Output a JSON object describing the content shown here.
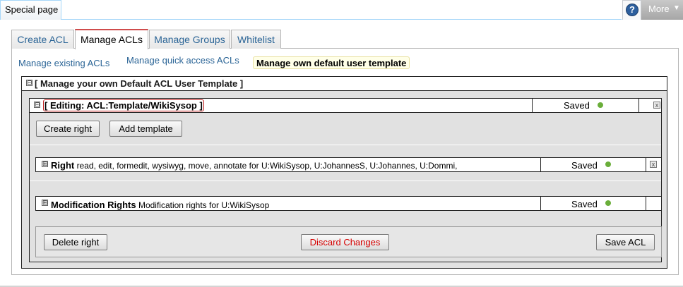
{
  "header": {
    "special_page": "Special page",
    "help_icon_glyph": "?",
    "more_label": "More",
    "more_arrow": "▼"
  },
  "tabs": [
    {
      "label": "Create ACL"
    },
    {
      "label": "Manage ACLs"
    },
    {
      "label": "Manage Groups"
    },
    {
      "label": "Whitelist"
    }
  ],
  "active_tab": "Manage ACLs",
  "subtabs": [
    {
      "label": "Manage existing ACLs"
    },
    {
      "label": "Manage quick access ACLs"
    },
    {
      "label": "Manage own default user template"
    }
  ],
  "active_subtab": "Manage own default user template",
  "panel": {
    "expander": "⊟",
    "title": "[ Manage your own Default ACL User Template ]"
  },
  "editing": {
    "expander": "⊟",
    "bracket_open": "[",
    "title": "Editing: ACL:Template/WikiSysop",
    "bracket_close": "]",
    "status": "Saved",
    "close_glyph": "x"
  },
  "buttons": {
    "create_right": "Create right",
    "add_template": "Add template",
    "delete_right": "Delete right",
    "discard_changes": "Discard Changes",
    "save_acl": "Save ACL"
  },
  "rights": [
    {
      "expander": "⊞",
      "title": "Right",
      "description": "read, edit, formedit, wysiwyg, move, annotate for U:WikiSysop, U:JohannesS, U:Johannes, U:Dommi,",
      "status": "Saved",
      "close_glyph": "x"
    },
    {
      "expander": "⊞",
      "title": "Modification Rights",
      "description": "Modification rights for U:WikiSysop",
      "status": "Saved"
    }
  ],
  "colors": {
    "status_dot": "#6aae3a",
    "link": "#2a6496",
    "danger": "#d60000"
  }
}
